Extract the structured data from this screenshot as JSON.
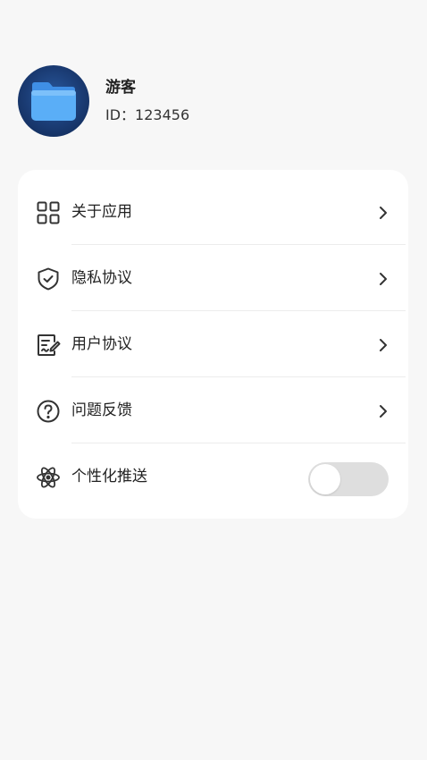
{
  "profile": {
    "name": "游客",
    "id_text": "ID：123456"
  },
  "menu": {
    "items": [
      {
        "label": "关于应用",
        "icon": "apps-grid-icon"
      },
      {
        "label": "隐私协议",
        "icon": "shield-check-icon"
      },
      {
        "label": "用户协议",
        "icon": "document-edit-icon"
      },
      {
        "label": "问题反馈",
        "icon": "question-circle-icon"
      },
      {
        "label": "个性化推送",
        "icon": "atom-icon",
        "toggle_on": false
      }
    ]
  },
  "colors": {
    "background": "#f7f7f7",
    "card": "#ffffff",
    "toggle_off": "#dedede",
    "avatar_blue": "#1a3b73",
    "folder_blue": "#4da3f5"
  }
}
